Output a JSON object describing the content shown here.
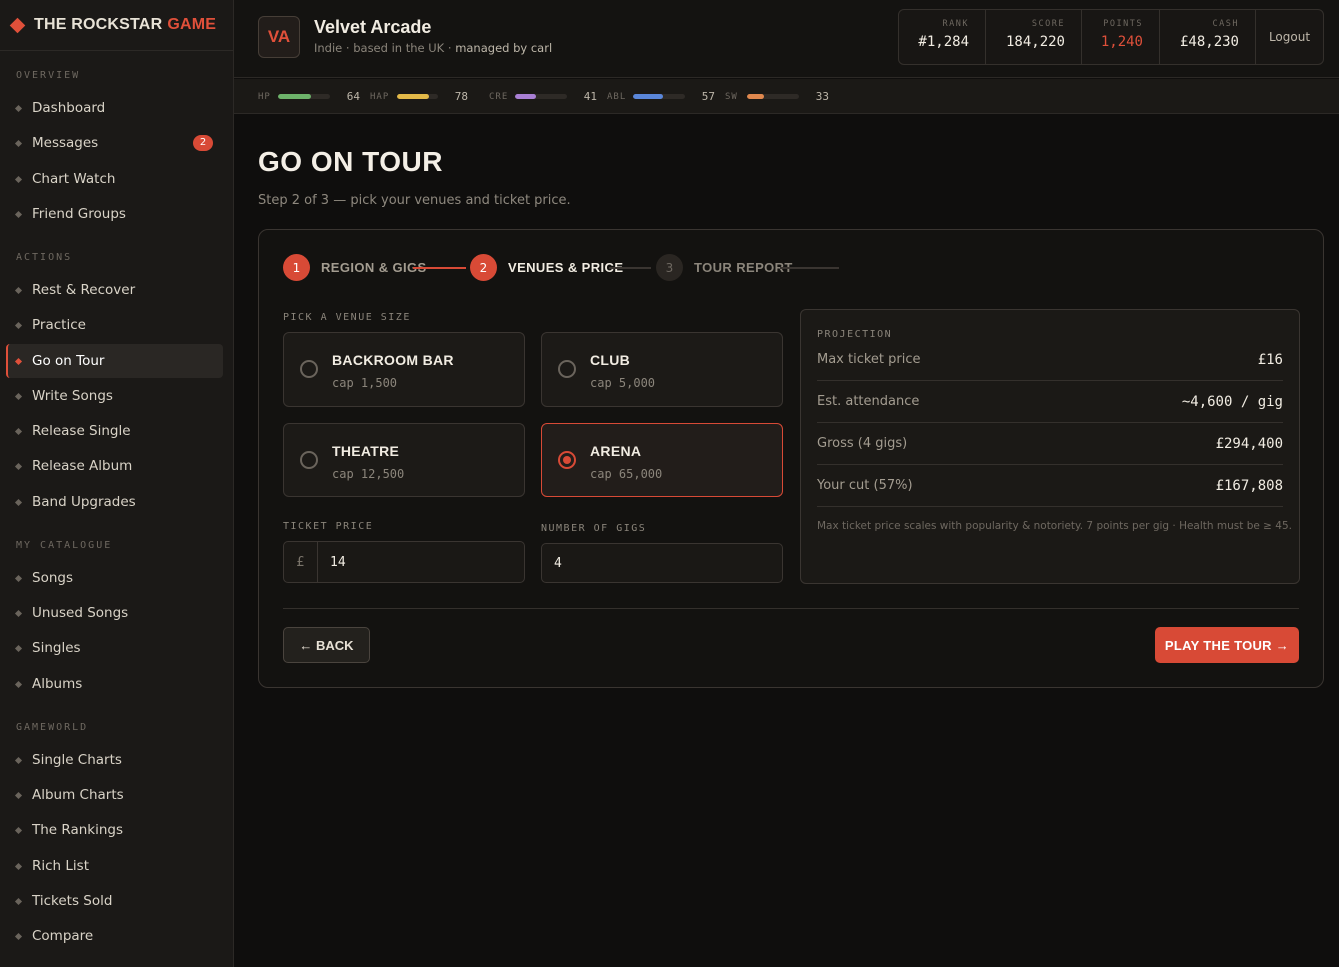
{
  "brand": {
    "name": "THE ROCKSTAR",
    "accent": "GAME",
    "accent_color": "#e0503a"
  },
  "sidebar": {
    "sections": [
      {
        "label": "OVERVIEW",
        "items": [
          {
            "label": "Dashboard"
          },
          {
            "label": "Messages",
            "badge": "2"
          },
          {
            "label": "Chart Watch"
          },
          {
            "label": "Friend Groups"
          }
        ]
      },
      {
        "label": "ACTIONS",
        "items": [
          {
            "label": "Rest & Recover"
          },
          {
            "label": "Practice"
          },
          {
            "label": "Go on Tour",
            "active": true
          },
          {
            "label": "Write Songs"
          },
          {
            "label": "Release Single"
          },
          {
            "label": "Release Album"
          },
          {
            "label": "Band Upgrades"
          }
        ]
      },
      {
        "label": "MY CATALOGUE",
        "items": [
          {
            "label": "Songs"
          },
          {
            "label": "Unused Songs"
          },
          {
            "label": "Singles"
          },
          {
            "label": "Albums"
          }
        ]
      },
      {
        "label": "GAMEWORLD",
        "items": [
          {
            "label": "Single Charts"
          },
          {
            "label": "Album Charts"
          },
          {
            "label": "The Rankings"
          },
          {
            "label": "Rich List"
          },
          {
            "label": "Tickets Sold"
          },
          {
            "label": "Compare"
          }
        ]
      }
    ]
  },
  "header": {
    "avatar_initials": "VA",
    "band_name": "Velvet Arcade",
    "band_meta": "Indie · based in the UK · ",
    "managed_by": "managed by carl",
    "stats": [
      {
        "label": "RANK",
        "value": "#1,284"
      },
      {
        "label": "SCORE",
        "value": "184,220"
      },
      {
        "label": "POINTS",
        "value": "1,240",
        "highlight": true
      },
      {
        "label": "CASH",
        "value": "£48,230"
      }
    ],
    "logout": "Logout"
  },
  "meters": [
    {
      "label": "HP",
      "value": "64",
      "pct": 0.64,
      "color": "#6db36a"
    },
    {
      "label": "HAP",
      "value": "78",
      "pct": 0.78,
      "color": "#e3b948"
    },
    {
      "label": "CRE",
      "value": "41",
      "pct": 0.41,
      "color": "#a97fd4"
    },
    {
      "label": "ABL",
      "value": "57",
      "pct": 0.57,
      "color": "#5a86d9"
    },
    {
      "label": "SW",
      "value": "33",
      "pct": 0.33,
      "color": "#e0884e"
    }
  ],
  "page": {
    "title": "GO ON TOUR",
    "subtitle": "Step 2 of 3 — pick your venues and ticket price."
  },
  "steps": [
    {
      "num": "1",
      "label": "REGION & GIGS",
      "state": "done"
    },
    {
      "num": "2",
      "label": "VENUES & PRICE",
      "state": "current"
    },
    {
      "num": "3",
      "label": "TOUR REPORT",
      "state": "upcoming"
    }
  ],
  "venue_section_label": "PICK A VENUE SIZE",
  "venues": [
    {
      "name": "BACKROOM BAR",
      "cap": "cap 1,500",
      "selected": false
    },
    {
      "name": "CLUB",
      "cap": "cap 5,000",
      "selected": false
    },
    {
      "name": "THEATRE",
      "cap": "cap 12,500",
      "selected": false
    },
    {
      "name": "ARENA",
      "cap": "cap 65,000",
      "selected": true
    }
  ],
  "ticket_price": {
    "label": "TICKET PRICE",
    "prefix": "£",
    "value": "14"
  },
  "gigs": {
    "label": "NUMBER OF GIGS",
    "value": "4"
  },
  "projection": {
    "label": "PROJECTION",
    "rows": [
      {
        "key": "Max ticket price",
        "value": "£16"
      },
      {
        "key": "Est. attendance",
        "value": "~4,600 / gig"
      },
      {
        "key": "Gross (4 gigs)",
        "value": "£294,400"
      },
      {
        "key": "Your cut (57%)",
        "value": "£167,808"
      }
    ],
    "note": "Max ticket price scales with popularity & notoriety. 7 points per gig · Health must be ≥ 45."
  },
  "buttons": {
    "back": "← BACK",
    "play": "PLAY THE TOUR →"
  }
}
